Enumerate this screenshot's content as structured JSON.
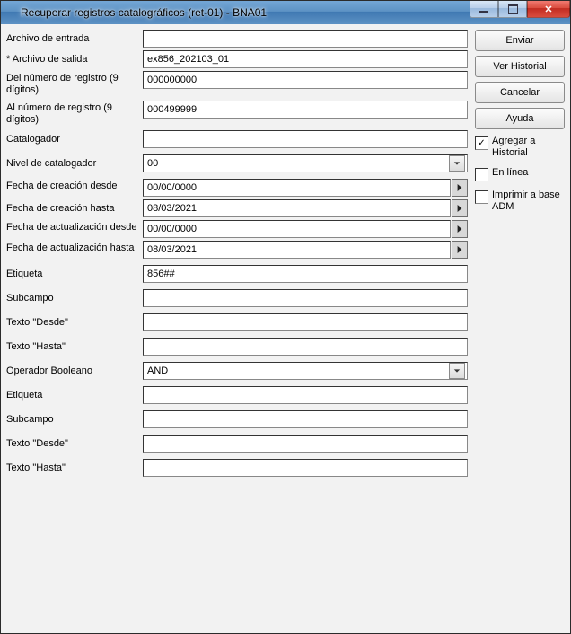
{
  "window": {
    "title": "Recuperar registros catalográficos (ret-01) - BNA01"
  },
  "labels": {
    "archivo_entrada": "Archivo de entrada",
    "archivo_salida": "* Archivo de salida",
    "del_numero": "Del número de registro (9 dígitos)",
    "al_numero": "Al número de registro (9 dígitos)",
    "catalogador": "Catalogador",
    "nivel_catalogador": "Nivel de catalogador",
    "fecha_creacion_desde": "Fecha de creación desde",
    "fecha_creacion_hasta": "Fecha de creación hasta",
    "fecha_actualizacion_desde": "Fecha de actualización desde",
    "fecha_actualizacion_hasta": "Fecha de actualización hasta",
    "etiqueta": "Etiqueta",
    "subcampo": "Subcampo",
    "texto_desde": "Texto \"Desde\"",
    "texto_hasta": "Texto \"Hasta\"",
    "operador_booleano": "Operador Booleano",
    "etiqueta2": "Etiqueta",
    "subcampo2": "Subcampo",
    "texto_desde2": "Texto \"Desde\"",
    "texto_hasta2": "Texto \"Hasta\""
  },
  "values": {
    "archivo_entrada": "",
    "archivo_salida": "ex856_202103_01",
    "del_numero": "000000000",
    "al_numero": "000499999",
    "catalogador": "",
    "nivel_catalogador": "00",
    "fecha_creacion_desde": "00/00/0000",
    "fecha_creacion_hasta": "08/03/2021",
    "fecha_actualizacion_desde": "00/00/0000",
    "fecha_actualizacion_hasta": "08/03/2021",
    "etiqueta": "856##",
    "subcampo": "",
    "texto_desde": "",
    "texto_hasta": "",
    "operador_booleano": "AND",
    "etiqueta2": "",
    "subcampo2": "",
    "texto_desde2": "",
    "texto_hasta2": ""
  },
  "side": {
    "enviar": "Enviar",
    "ver_historial": "Ver Historial",
    "cancelar": "Cancelar",
    "ayuda": "Ayuda",
    "agregar_historial": "Agregar a Historial",
    "en_linea": "En línea",
    "imprimir_base_adm": "Imprimir a base ADM"
  },
  "checks": {
    "agregar_historial": true,
    "en_linea": false,
    "imprimir_base_adm": false
  }
}
